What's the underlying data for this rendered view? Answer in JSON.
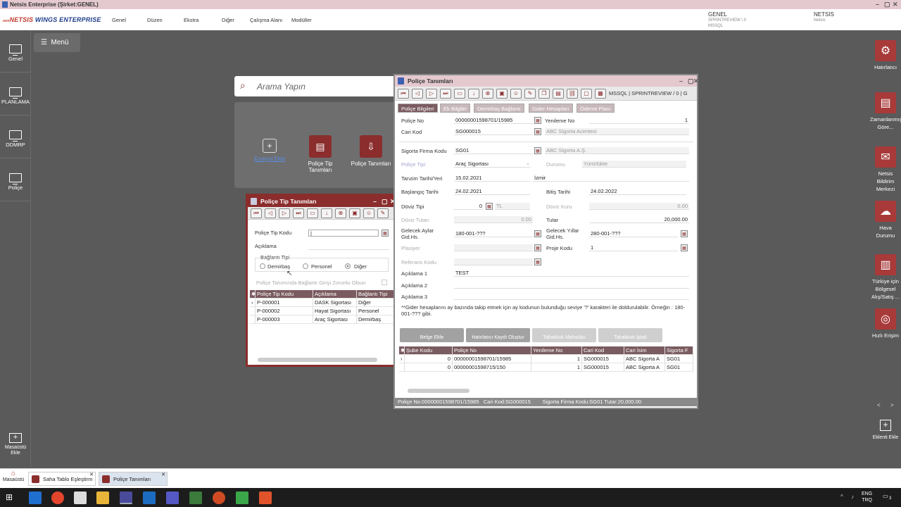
{
  "titlebar": {
    "title": "Netsis Enterprise (Şirket:GENEL)"
  },
  "brand": {
    "prefix": "oen",
    "name": "NETSIS",
    "suffix": " WINGS ENTERPRISE"
  },
  "menubar": {
    "items": [
      "Genel",
      "Düzen",
      "Ekstra",
      "Diğer",
      "Çalışma Alanı",
      "Modüller"
    ],
    "company": "GENEL",
    "server": "SPRINTREVIEW \\ 0",
    "db": "MSSQL",
    "user": "NETSIS",
    "user_sub": "Netsis"
  },
  "left_rail": [
    "Genel",
    "PLANLAMA",
    "DDMRP",
    "Poliçe"
  ],
  "left_bottom": "Masaüstü Ekle",
  "right_rail": [
    "Hatırlatıcı",
    "Zamanlanmış Göre...",
    "Netsis Bildirim Merkezi",
    "Hava Durumu",
    "Türkiye için Bölgesel Alış/Satış ...",
    "Hızlı Erişim"
  ],
  "right_bottom": "Eklenti Ekle",
  "right_nav": {
    "prev": "<",
    "next": ">"
  },
  "desktop": {
    "menu_label": "Menü",
    "search_placeholder": "Arama Yapın",
    "tiles": [
      {
        "label": "Kısayol Ekle"
      },
      {
        "label": "Poliçe Tip Tanımları"
      },
      {
        "label": "Poliçe Tanımları"
      }
    ]
  },
  "win_tip": {
    "title": "Poliçe Tip Tanımları",
    "labels": {
      "kod": "Poliçe Tip Kodu",
      "aciklama": "Açıklama",
      "baglanti": "Bağlantı Tipi",
      "zorunlu": "Poliçe Tanımında Bağlantı Girişi Zorunlu Olsun"
    },
    "radios": [
      "Demirbaş",
      "Personel",
      "Diğer"
    ],
    "selected_radio": "Diğer",
    "columns": [
      "Poliçe Tip Kodu",
      "Açıklama",
      "Bağlantı Tipi"
    ],
    "rows": [
      [
        "P-000001",
        "DASK Sigortası",
        "Diğer"
      ],
      [
        "P-000002",
        "Hayat Sigortası",
        "Personel"
      ],
      [
        "P-000003",
        "Araç Sigortası",
        "Demirbaş"
      ]
    ]
  },
  "win_pol": {
    "title": "Poliçe Tanımları",
    "toolbar_info": "MSSQL | SPRINTREVIEW / 0 | G",
    "tabs": [
      "Poliçe Bilgileri",
      "Ek Bilgiler",
      "Demirbaş Bağlantı",
      "Gider Hesapları",
      "Ödeme Planı"
    ],
    "f": {
      "police_no_l": "Poliçe No",
      "police_no": "00000001598701/15985",
      "yenileme_l": "Yenileme No",
      "yenileme": "1",
      "cari_l": "Cari Kod",
      "cari": "SG000015",
      "cari_ad": "ABC Sigorta Acentesi",
      "firma_l": "Sigorta Firma Kodu",
      "firma": "SG01",
      "firma_ad": "ABC Sigorta A.Ş.",
      "tipi_l": "Poliçe Tipi",
      "tipi": "Araç Sigortası",
      "durum_l": "Durumu",
      "durum": "Yürürlükte",
      "tanzim_l": "Tanzim Tarihi/Yeri",
      "tanzim": "15.02.2021",
      "yer": "İzmir",
      "bas_l": "Başlangıç Tarihi",
      "bas": "24.02.2021",
      "bit_l": "Bitiş Tarihi",
      "bit": "24.02.2022",
      "doviz_l": "Döviz Tipi",
      "doviz": "0",
      "doviz_tl": "TL",
      "kuru_l": "Döviz Kuru",
      "kuru": "0.00",
      "dtutar_l": "Döviz Tutarı",
      "dtutar": "0.00",
      "tutar_l": "Tutar",
      "tutar": "20,000.00",
      "gay_l": "Gelecek Aylar Gid.Hs.",
      "gay": "180-001-???",
      "gyil_l": "Gelecek Yıllar Gid.Hs.",
      "gyil": "280-001-???",
      "plasiyer_l": "Plasiyer",
      "proje_l": "Proje Kodu",
      "proje": "1",
      "ref_l": "Referans Kodu",
      "ac1_l": "Açıklama 1",
      "ac1": "TEST",
      "ac2_l": "Açıklama 2",
      "ac3_l": "Açıklama 3",
      "note": "**Gider hesaplarını ay bazında takip etmek için ay kodunun bulunduğu seviye '?' karakteri ile doldurulabilir. Örneğin : 180-001-??? gibi."
    },
    "buttons": [
      "Belge Ekle",
      "Hatırlatıcı Kaydı Oluştur",
      "Tahakkuk Mahsubu",
      "Tahakkuk İptali"
    ],
    "columns": [
      "Şube Kodu",
      "Poliçe No",
      "Yenileme No",
      "Cari Kod",
      "Cari İsim",
      "Sigorta F"
    ],
    "rows": [
      [
        "0",
        "00000001598701/15985",
        "1",
        "SG000015",
        "ABC Sigorta A",
        "SG01"
      ],
      [
        "0",
        "00000001598715/150",
        "1",
        "SG000015",
        "ABC Sigorta A",
        "SG01"
      ]
    ],
    "status": "Poliçe No:00000001598701/15985   Cari Kod:SG000015        Sigorta Firma Kodu:SG01 Tutar:20,000.00"
  },
  "apptabs": {
    "home": "Masaüstü",
    "tabs": [
      "Saha Tablo Eşleştirm",
      "Poliçe Tanımları"
    ]
  },
  "tray": {
    "lang": "ENG",
    "lang2": "TRQ",
    "notif": "3"
  }
}
